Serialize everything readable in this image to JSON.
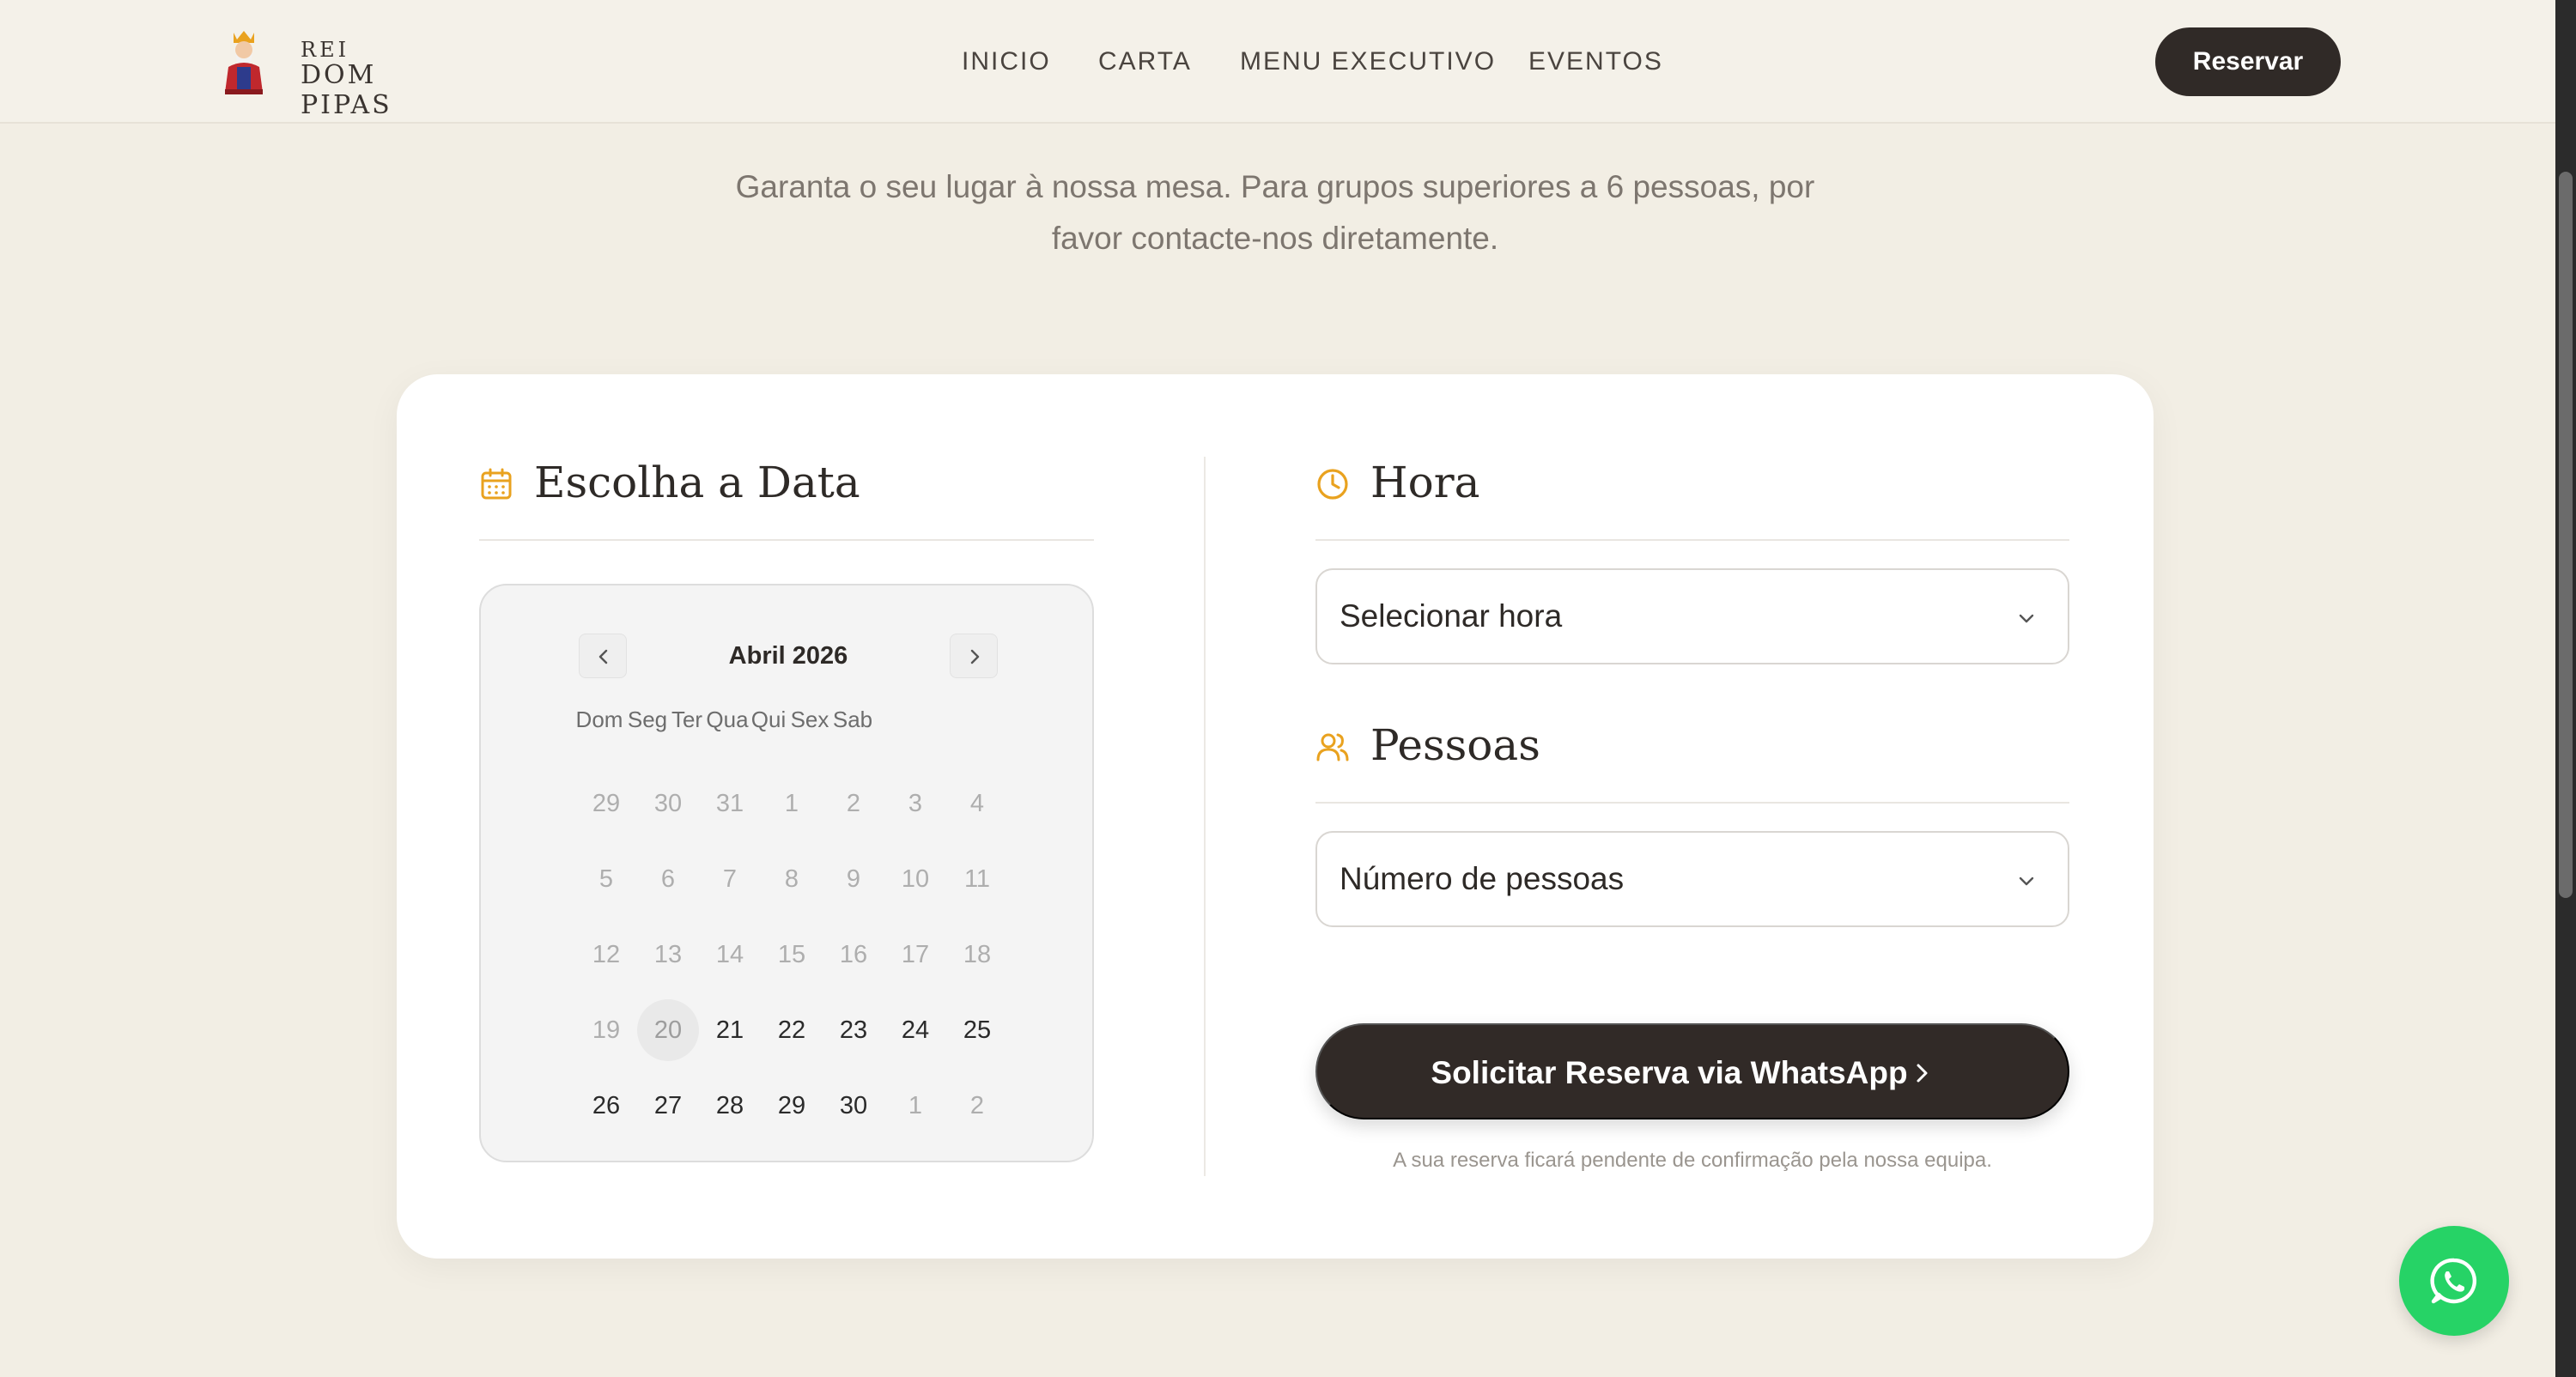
{
  "brand": {
    "top": "REI",
    "bottom": "DOM PIPAS"
  },
  "nav": {
    "items": [
      "INICIO",
      "CARTA",
      "MENU EXECUTIVO",
      "EVENTOS"
    ]
  },
  "header": {
    "reserve_label": "Reservar"
  },
  "intro": {
    "text": "Garanta o seu lugar à nossa mesa. Para grupos superiores a 6 pessoas, por favor contacte-nos diretamente."
  },
  "date_section": {
    "title": "Escolha a Data"
  },
  "calendar": {
    "month": "Abril 2026",
    "weekdays": [
      "Dom",
      "Seg",
      "Ter",
      "Qua",
      "Qui",
      "Sex",
      "Sab"
    ],
    "weeks": [
      [
        "29",
        "30",
        "31",
        "1",
        "2",
        "3",
        "4"
      ],
      [
        "5",
        "6",
        "7",
        "8",
        "9",
        "10",
        "11"
      ],
      [
        "12",
        "13",
        "14",
        "15",
        "16",
        "17",
        "18"
      ],
      [
        "19",
        "20",
        "21",
        "22",
        "23",
        "24",
        "25"
      ],
      [
        "26",
        "27",
        "28",
        "29",
        "30",
        "1",
        "2"
      ]
    ],
    "today": "20"
  },
  "time_section": {
    "title": "Hora",
    "placeholder": "Selecionar hora"
  },
  "people_section": {
    "title": "Pessoas",
    "placeholder": "Número de pessoas"
  },
  "submit": {
    "label": "Solicitar Reserva via WhatsApp"
  },
  "note": "A sua reserva ficará pendente de confirmação pela nossa equipa.",
  "colors": {
    "accent": "#e9a21f",
    "dark": "#302a27",
    "whatsapp": "#26d366",
    "background": "#f2eee4"
  },
  "icons": [
    "calendar-icon",
    "clock-icon",
    "users-icon",
    "chevron-down-icon",
    "chevron-right-icon",
    "chevron-left-icon",
    "whatsapp-icon"
  ]
}
